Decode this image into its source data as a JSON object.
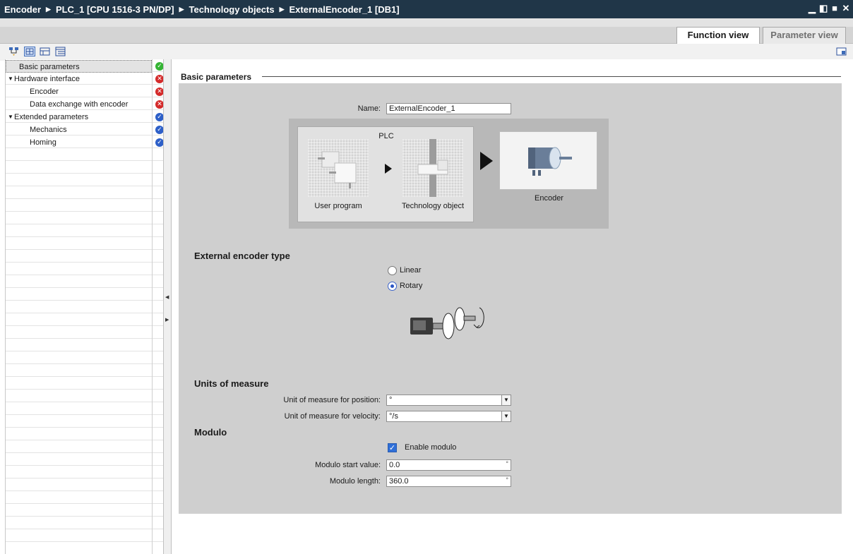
{
  "breadcrumb": [
    "Encoder",
    "PLC_1 [CPU 1516-3 PN/DP]",
    "Technology objects",
    "ExternalEncoder_1 [DB1]"
  ],
  "view_tabs": {
    "function_view": "Function view",
    "parameter_view": "Parameter view"
  },
  "toolbar": {
    "icons": [
      "network-icon",
      "function-view-icon",
      "collapse-icon",
      "expand-icon"
    ],
    "right_icon": "panel-icon"
  },
  "nav": [
    {
      "label": "Basic parameters",
      "status": "ok",
      "selected": true
    },
    {
      "label": "Hardware interface",
      "status": "error"
    },
    {
      "label": "Encoder",
      "status": "error"
    },
    {
      "label": "Data exchange with encoder",
      "status": "error"
    },
    {
      "label": "Extended parameters",
      "status": "valid"
    },
    {
      "label": "Mechanics",
      "status": "valid"
    },
    {
      "label": "Homing",
      "status": "valid"
    }
  ],
  "main": {
    "section_title": "Basic parameters",
    "name_label": "Name:",
    "name_value": "ExternalEncoder_1",
    "diagram": {
      "plc_label": "PLC",
      "user_program": "User program",
      "technology_object": "Technology object",
      "encoder": "Encoder"
    },
    "encoder_type": {
      "title": "External encoder type",
      "options": [
        "Linear",
        "Rotary"
      ],
      "selected": "Rotary"
    },
    "units": {
      "title": "Units of measure",
      "position_label": "Unit of measure for position:",
      "position_value": "°",
      "velocity_label": "Unit of measure for velocity:",
      "velocity_value": "°/s"
    },
    "modulo": {
      "title": "Modulo",
      "enable_label": "Enable modulo",
      "enabled": true,
      "start_label": "Modulo start value:",
      "start_value": "0.0",
      "length_label": "Modulo length:",
      "length_value": "360.0",
      "unit": "°"
    }
  },
  "colors": {
    "titlebar": "#203648",
    "status_ok": "#35b434",
    "status_error": "#d42a2a",
    "status_valid": "#2d5fc8"
  }
}
